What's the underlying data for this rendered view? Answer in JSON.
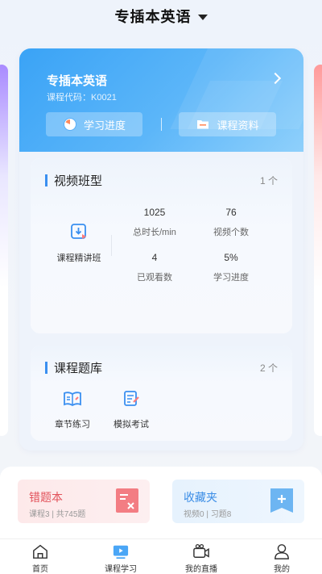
{
  "header": {
    "title": "专插本英语"
  },
  "course_card": {
    "name": "专插本英语",
    "code": "课程代码：K0021",
    "progress_button": "学习进度",
    "materials_button": "课程资料"
  },
  "video_section": {
    "title": "视频班型",
    "count": "1 个",
    "item_label": "课程精讲班",
    "stats": [
      {
        "value": "1025",
        "caption": "总时长/min"
      },
      {
        "value": "76",
        "caption": "视频个数"
      },
      {
        "value": "4",
        "caption": "已观看数"
      },
      {
        "value": "5%",
        "caption": "学习进度"
      }
    ]
  },
  "bank_section": {
    "title": "课程题库",
    "count": "2 个",
    "items": [
      {
        "label": "章节练习"
      },
      {
        "label": "模拟考试"
      }
    ]
  },
  "wrong_card": {
    "title": "错题本",
    "subtitle": "课程3 | 共745题"
  },
  "fav_card": {
    "title": "收藏夹",
    "subtitle": "视频0 | 习题8"
  },
  "tabs": [
    {
      "label": "首页"
    },
    {
      "label": "课程学习"
    },
    {
      "label": "我的直播"
    },
    {
      "label": "我的"
    }
  ],
  "colors": {
    "accent": "#3a8ff0",
    "banner": "#4dadf7",
    "wrong": "#e2525b",
    "fav": "#3b8de6"
  }
}
